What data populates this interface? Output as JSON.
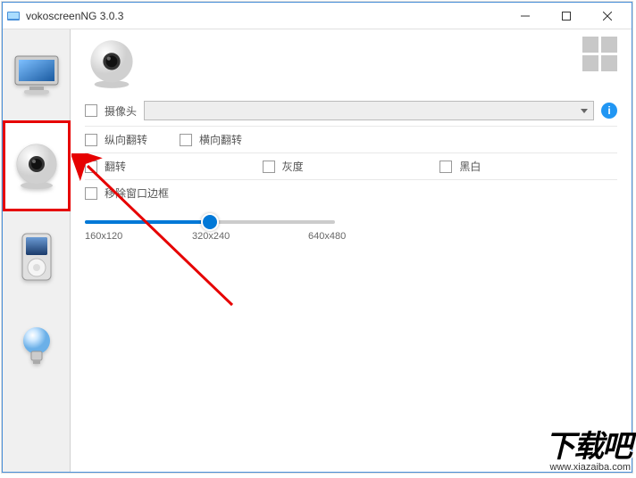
{
  "window": {
    "title": "vokoscreenNG 3.0.3"
  },
  "sidebar": {
    "tabs": [
      "screen",
      "webcam",
      "ipod",
      "bulb"
    ]
  },
  "webcam_panel": {
    "camera_label": "摄像头",
    "flip_v": "纵向翻转",
    "flip_h": "横向翻转",
    "flip": "翻转",
    "grayscale": "灰度",
    "bw": "黑白",
    "remove_border": "移除窗口边框",
    "info": "i",
    "slider": {
      "ticks": [
        "160x120",
        "320x240",
        "640x480"
      ],
      "value_index": 1
    }
  },
  "watermark": {
    "text": "下载吧",
    "url": "www.xiazaiba.com"
  }
}
